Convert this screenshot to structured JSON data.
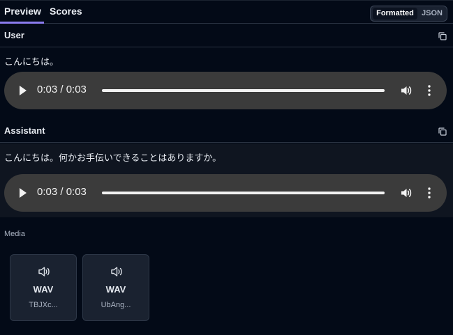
{
  "tabs": [
    {
      "label": "Preview",
      "active": true
    },
    {
      "label": "Scores",
      "active": false
    }
  ],
  "view_toggle": {
    "options": [
      "Formatted",
      "JSON"
    ],
    "selected": "Formatted"
  },
  "colors": {
    "accent": "#8b7cf0",
    "background": "#030a17",
    "player": "#3b3b3b"
  },
  "messages": [
    {
      "role": "User",
      "text": "こんにちは。",
      "audio": {
        "time": "0:03 / 0:03"
      }
    },
    {
      "role": "Assistant",
      "text": "こんにちは。何かお手伝いできることはありますか。",
      "audio": {
        "time": "0:03 / 0:03"
      }
    }
  ],
  "media": {
    "label": "Media",
    "items": [
      {
        "format": "WAV",
        "name": "TBJXc...",
        "icon": "speaker-icon"
      },
      {
        "format": "WAV",
        "name": "UbAng...",
        "icon": "speaker-icon"
      }
    ]
  }
}
